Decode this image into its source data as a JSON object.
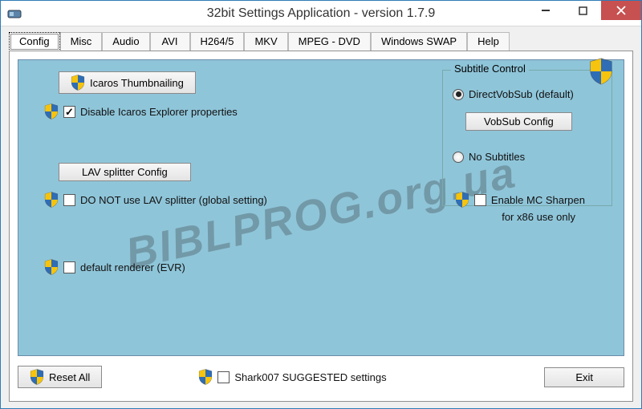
{
  "window": {
    "title": "32bit Settings Application - version 1.7.9"
  },
  "tabs": [
    "Config",
    "Misc",
    "Audio",
    "AVI",
    "H264/5",
    "MKV",
    "MPEG - DVD",
    "Windows SWAP",
    "Help"
  ],
  "active_tab": "Config",
  "config": {
    "icaros_btn": "Icaros Thumbnailing",
    "disable_icaros_label": "Disable Icaros Explorer properties",
    "disable_icaros_checked": true,
    "lav_btn": "LAV splitter Config",
    "no_lav_label": "DO NOT use LAV splitter (global setting)",
    "no_lav_checked": false,
    "default_renderer_label": "default renderer (EVR)",
    "default_renderer_checked": false,
    "subtitle_group": "Subtitle Control",
    "radio_dvs": "DirectVobSub (default)",
    "vobsub_btn": "VobSub Config",
    "radio_nosub": "No Subtitles",
    "subtitle_selected": "dvs",
    "mc_sharpen_label": "Enable MC Sharpen",
    "mc_sharpen_sub": "for x86 use only",
    "mc_sharpen_checked": false
  },
  "footer": {
    "reset_btn": "Reset All",
    "suggested_label": "Shark007 SUGGESTED settings",
    "suggested_checked": false,
    "exit_btn": "Exit"
  },
  "watermark": "BIBLPROG.org.ua"
}
